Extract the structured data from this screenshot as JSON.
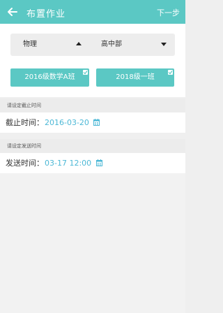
{
  "header": {
    "title": "布置作业",
    "next_label": "下一步",
    "back_icon": "back-arrow-icon"
  },
  "filters": {
    "subject": "物理",
    "grade": "高中部"
  },
  "classes": [
    {
      "label": "2016级数学A班",
      "checked": true
    },
    {
      "label": "2018级一班",
      "checked": true
    }
  ],
  "deadline": {
    "section_label": "请设定截止时间",
    "key": "截止时间：",
    "value": "2016-03-20",
    "icon": "calendar-icon"
  },
  "send_time": {
    "section_label": "请设定发送时间",
    "key": "发送时间：",
    "value": "03-17 12:00",
    "icon": "calendar-icon"
  },
  "colors": {
    "accent": "#5bc8c4",
    "value_text": "#4db8d6",
    "background": "#efefef"
  }
}
